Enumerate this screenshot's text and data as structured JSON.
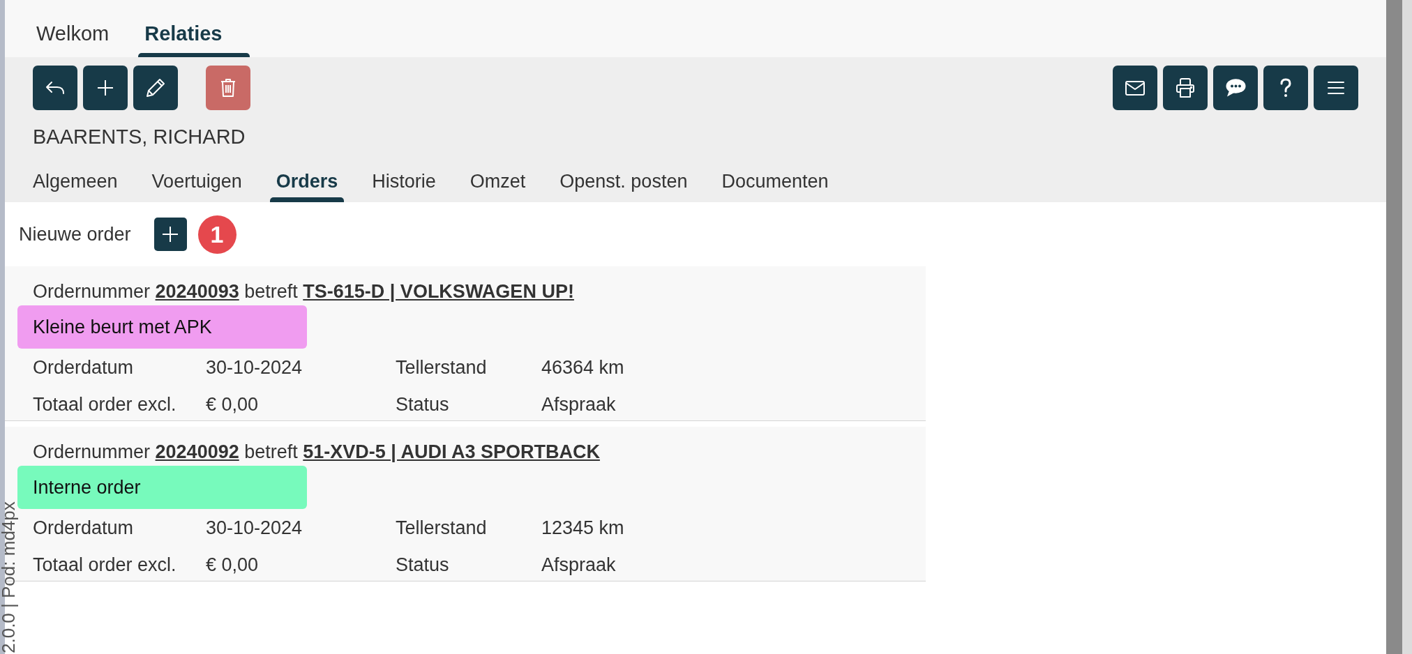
{
  "main_tabs": [
    {
      "label": "Welkom",
      "selected": false
    },
    {
      "label": "Relaties",
      "selected": true
    }
  ],
  "relation_name": "BAARENTS, RICHARD",
  "sub_tabs": [
    {
      "label": "Algemeen",
      "selected": false
    },
    {
      "label": "Voertuigen",
      "selected": false
    },
    {
      "label": "Orders",
      "selected": true
    },
    {
      "label": "Historie",
      "selected": false
    },
    {
      "label": "Omzet",
      "selected": false
    },
    {
      "label": "Openst. posten",
      "selected": false
    },
    {
      "label": "Documenten",
      "selected": false
    }
  ],
  "new_order": {
    "label": "Nieuwe order",
    "badge": "1"
  },
  "orders": [
    {
      "order_label": "Ordernummer",
      "order_number": "20240093",
      "connector": "betreft",
      "vehicle": "TS-615-D | VOLKSWAGEN UP!",
      "tag": {
        "label": "Kleine beurt met APK",
        "color": "#f09cf0"
      },
      "fields": [
        {
          "label": "Orderdatum",
          "value": "30-10-2024"
        },
        {
          "label": "Tellerstand",
          "value": "46364 km"
        },
        {
          "label": "Totaal order excl.",
          "value": "€ 0,00"
        },
        {
          "label": "Status",
          "value": "Afspraak"
        }
      ]
    },
    {
      "order_label": "Ordernummer",
      "order_number": "20240092",
      "connector": "betreft",
      "vehicle": "51-XVD-5 | AUDI A3 SPORTBACK",
      "tag": {
        "label": "Interne order",
        "color": "#77fabc"
      },
      "fields": [
        {
          "label": "Orderdatum",
          "value": "30-10-2024"
        },
        {
          "label": "Tellerstand",
          "value": "12345 km"
        },
        {
          "label": "Totaal order excl.",
          "value": "€ 0,00"
        },
        {
          "label": "Status",
          "value": "Afspraak"
        }
      ]
    }
  ],
  "version_label": "2.0.0 | Pod: md4px"
}
